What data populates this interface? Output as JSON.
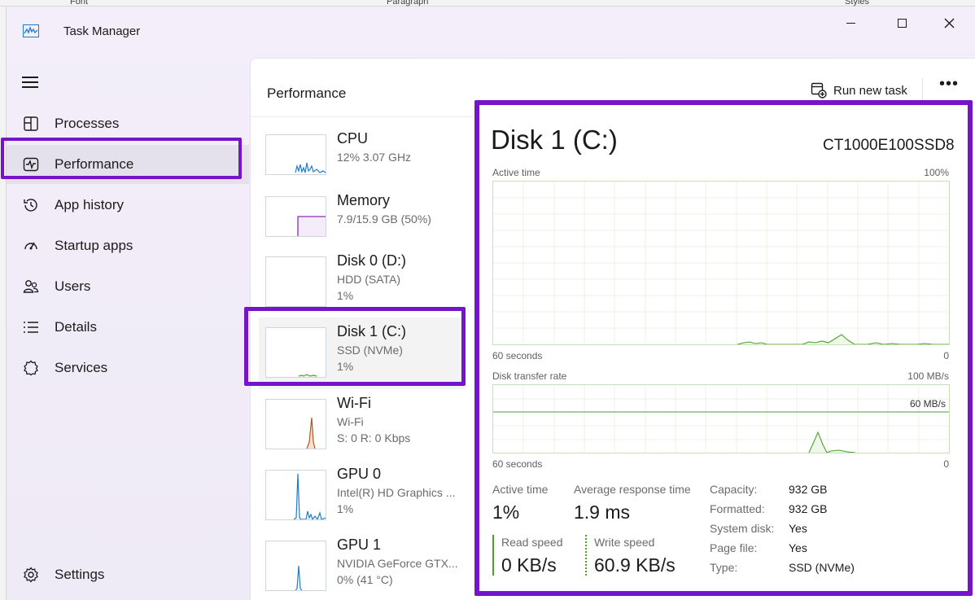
{
  "background": {
    "ribbon_labels": [
      "Font",
      "Paragraph",
      "Styles"
    ]
  },
  "window": {
    "title": "Task Manager"
  },
  "nav": {
    "items": [
      {
        "label": "Processes",
        "icon": "processes-icon"
      },
      {
        "label": "Performance",
        "icon": "performance-icon"
      },
      {
        "label": "App history",
        "icon": "history-icon"
      },
      {
        "label": "Startup apps",
        "icon": "startup-icon"
      },
      {
        "label": "Users",
        "icon": "users-icon"
      },
      {
        "label": "Details",
        "icon": "details-icon"
      },
      {
        "label": "Services",
        "icon": "services-icon"
      }
    ],
    "settings_label": "Settings",
    "active": "Performance"
  },
  "header": {
    "title": "Performance",
    "run_new_task": "Run new task"
  },
  "devices": [
    {
      "name": "CPU",
      "line1": "12% 3.07 GHz",
      "line2": ""
    },
    {
      "name": "Memory",
      "line1": "7.9/15.9 GB (50%)",
      "line2": ""
    },
    {
      "name": "Disk 0 (D:)",
      "line1": "HDD (SATA)",
      "line2": "1%"
    },
    {
      "name": "Disk 1 (C:)",
      "line1": "SSD (NVMe)",
      "line2": "1%"
    },
    {
      "name": "Wi-Fi",
      "line1": "Wi-Fi",
      "line2": "S: 0 R: 0 Kbps"
    },
    {
      "name": "GPU 0",
      "line1": "Intel(R) HD Graphics ...",
      "line2": "1%"
    },
    {
      "name": "GPU 1",
      "line1": "NVIDIA GeForce GTX...",
      "line2": "0% (41 °C)"
    }
  ],
  "detail": {
    "title": "Disk 1 (C:)",
    "model": "CT1000E100SSD8",
    "active_time_graph": {
      "label": "Active time",
      "max": "100%",
      "time": "60 seconds",
      "min": "0"
    },
    "transfer_graph": {
      "label": "Disk transfer rate",
      "max": "100 MB/s",
      "mid": "60 MB/s",
      "time": "60 seconds",
      "min": "0"
    },
    "stats": {
      "active_time_label": "Active time",
      "active_time_value": "1%",
      "avg_response_label": "Average response time",
      "avg_response_value": "1.9 ms",
      "read_label": "Read speed",
      "read_value": "0 KB/s",
      "write_label": "Write speed",
      "write_value": "60.9 KB/s"
    },
    "properties": [
      {
        "key": "Capacity:",
        "value": "932 GB"
      },
      {
        "key": "Formatted:",
        "value": "932 GB"
      },
      {
        "key": "System disk:",
        "value": "Yes"
      },
      {
        "key": "Page file:",
        "value": "Yes"
      },
      {
        "key": "Type:",
        "value": "SSD (NVMe)"
      }
    ]
  },
  "colors": {
    "accent": "#7415c9",
    "disk_green": "#4da12b",
    "memory_purple": "#8b2fb5",
    "wifi_orange": "#b5561d",
    "cpu_blue": "#1f7ccb"
  }
}
